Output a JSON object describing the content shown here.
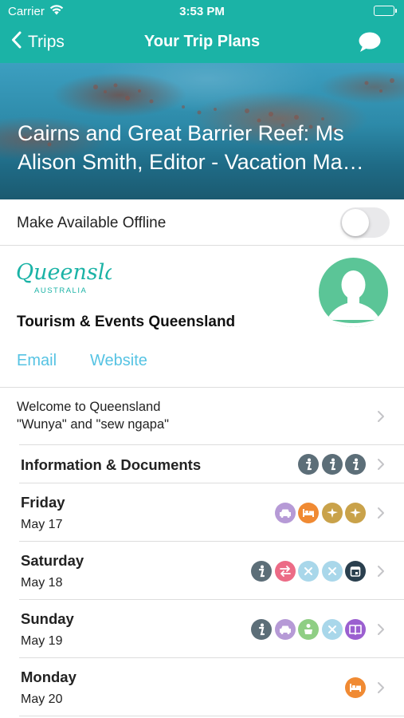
{
  "status_bar": {
    "carrier": "Carrier",
    "time": "3:53 PM"
  },
  "nav": {
    "back_label": "Trips",
    "title": "Your Trip Plans",
    "chat_icon": "chat-bubble-icon"
  },
  "hero": {
    "title_line1": "Cairns and Great Barrier Reef: Ms",
    "title_line2": "Alison Smith, Editor - Vacation Magazine"
  },
  "offline": {
    "label": "Make Available Offline",
    "enabled": false
  },
  "organizer": {
    "logo_script": "Queensland",
    "logo_sub": "AUSTRALIA",
    "name": "Tourism & Events Queensland",
    "email_label": "Email",
    "website_label": "Website"
  },
  "welcome": {
    "line1": "Welcome to Queensland",
    "line2": "\"Wunya\" and \"sew ngapa\""
  },
  "rows": [
    {
      "title": "Information & Documents",
      "subtitle": "",
      "icons": [
        "info",
        "info",
        "info"
      ]
    },
    {
      "title": "Friday",
      "subtitle": "May 17",
      "icons": [
        "car",
        "bed",
        "plane",
        "plane"
      ]
    },
    {
      "title": "Saturday",
      "subtitle": "May 18",
      "icons": [
        "info",
        "transfer",
        "cross",
        "cross",
        "calendar"
      ]
    },
    {
      "title": "Sunday",
      "subtitle": "May 19",
      "icons": [
        "info",
        "car",
        "restaurant",
        "cross",
        "book"
      ]
    },
    {
      "title": "Monday",
      "subtitle": "May 20",
      "icons": [
        "bed"
      ]
    }
  ],
  "icon_colors": {
    "info": "#5c6e78",
    "car": "#b69ad6",
    "bed": "#f08a33",
    "plane": "#c9a24a",
    "transfer": "#ec6b86",
    "cross": "#a9d7ea",
    "calendar": "#2a3f4e",
    "restaurant": "#8fce84",
    "book": "#9b5fd0"
  },
  "colors": {
    "accent": "#1bb3a6",
    "link": "#56c3e3",
    "avatar": "#5bc597"
  }
}
